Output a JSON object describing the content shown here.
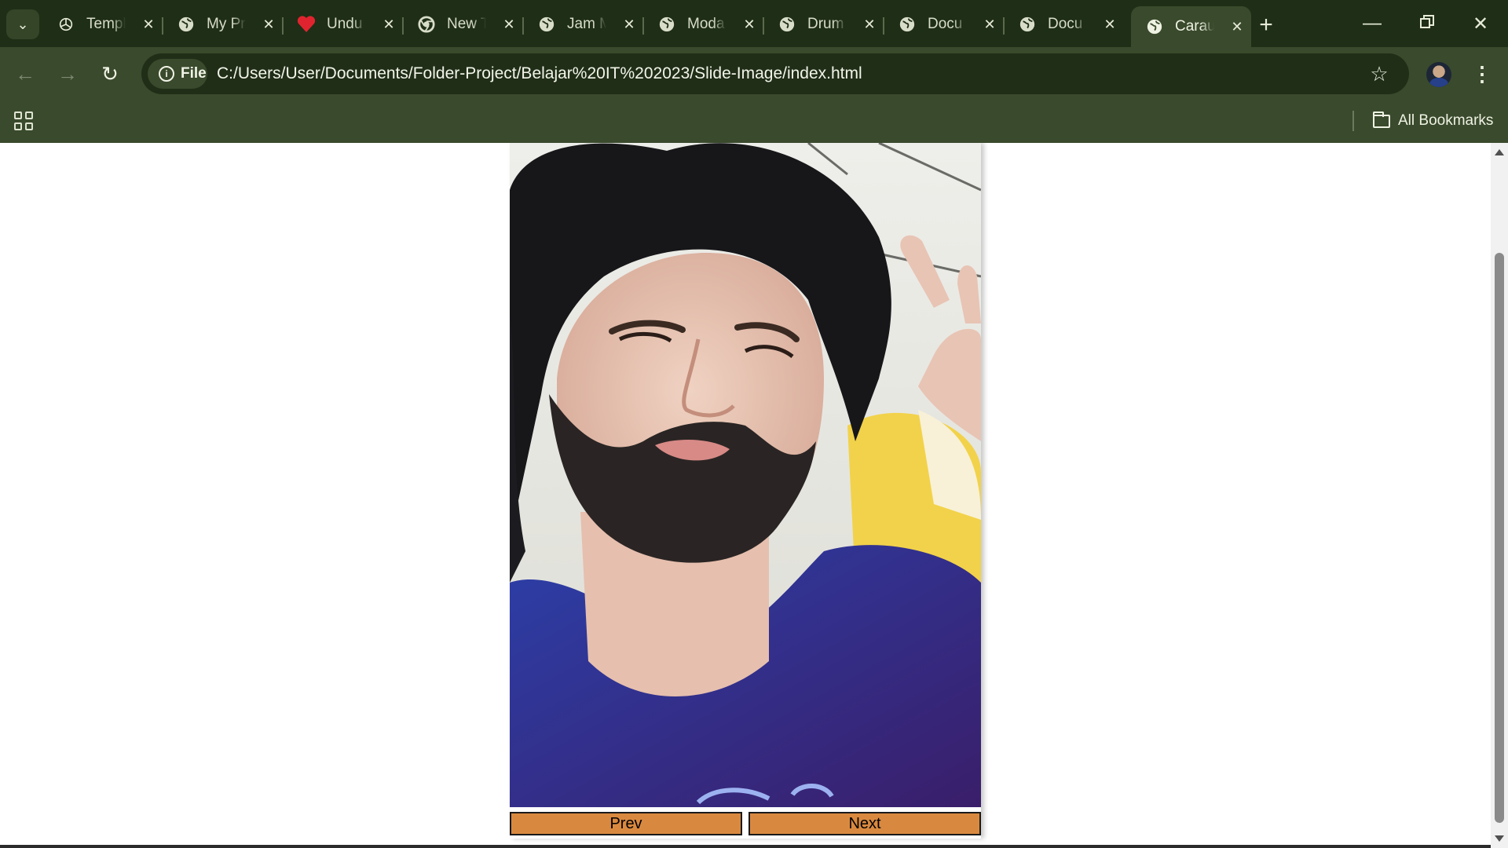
{
  "browser": {
    "tabs": [
      {
        "title": "Templ",
        "favicon": "openai-icon",
        "active": false
      },
      {
        "title": "My Pr",
        "favicon": "globe-icon",
        "active": false
      },
      {
        "title": "Undu",
        "favicon": "heart-icon",
        "active": false
      },
      {
        "title": "New T",
        "favicon": "chrome-icon",
        "active": false
      },
      {
        "title": "Jam M",
        "favicon": "globe-icon",
        "active": false
      },
      {
        "title": "Moda",
        "favicon": "globe-icon",
        "active": false
      },
      {
        "title": "Drum",
        "favicon": "globe-icon",
        "active": false
      },
      {
        "title": "Docu",
        "favicon": "globe-icon",
        "active": false
      },
      {
        "title": "Docu",
        "favicon": "globe-icon",
        "active": false
      },
      {
        "title": "Carau",
        "favicon": "globe-icon",
        "active": true
      }
    ],
    "new_tab_icon": "plus-icon",
    "window_controls": {
      "minimize": "minimize-icon",
      "restore": "restore-icon",
      "close": "close-icon"
    },
    "toolbar": {
      "back_icon": "back-arrow-icon",
      "forward_icon": "forward-arrow-icon",
      "reload_icon": "reload-icon",
      "site_chip": "File",
      "url": "C:/Users/User/Documents/Folder-Project/Belajar%20IT%202023/Slide-Image/index.html",
      "bookmark_icon": "star-icon",
      "menu_icon": "kebab-menu-icon"
    },
    "bookmarks_bar": {
      "apps_icon": "apps-grid-icon",
      "all_bookmarks": "All Bookmarks"
    }
  },
  "page": {
    "carousel": {
      "prev_label": "Prev",
      "next_label": "Next",
      "button_color": "#d9893f"
    }
  },
  "colors": {
    "tabstrip": "#1f2e16",
    "toolbar": "#3a4a2c",
    "omnibox": "#202e18"
  }
}
